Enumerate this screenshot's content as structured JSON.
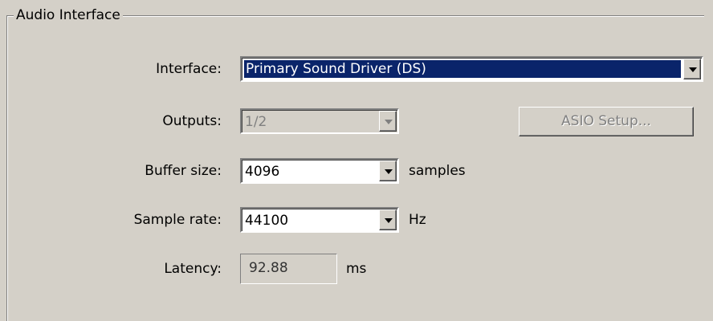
{
  "group": {
    "title": "Audio Interface"
  },
  "interface": {
    "label": "Interface:",
    "value": "Primary Sound Driver (DS)"
  },
  "outputs": {
    "label": "Outputs:",
    "value": "1/2"
  },
  "asio": {
    "label": "ASIO Setup..."
  },
  "buffer": {
    "label": "Buffer size:",
    "value": "4096",
    "unit": "samples"
  },
  "samplerate": {
    "label": "Sample rate:",
    "value": "44100",
    "unit": "Hz"
  },
  "latency": {
    "label": "Latency:",
    "value": "92.88",
    "unit": "ms"
  },
  "icons": {
    "dropdown": "chevron-down-icon"
  },
  "colors": {
    "background": "#d4d0c8",
    "selection": "#0a246a",
    "disabled_text": "#808080"
  }
}
